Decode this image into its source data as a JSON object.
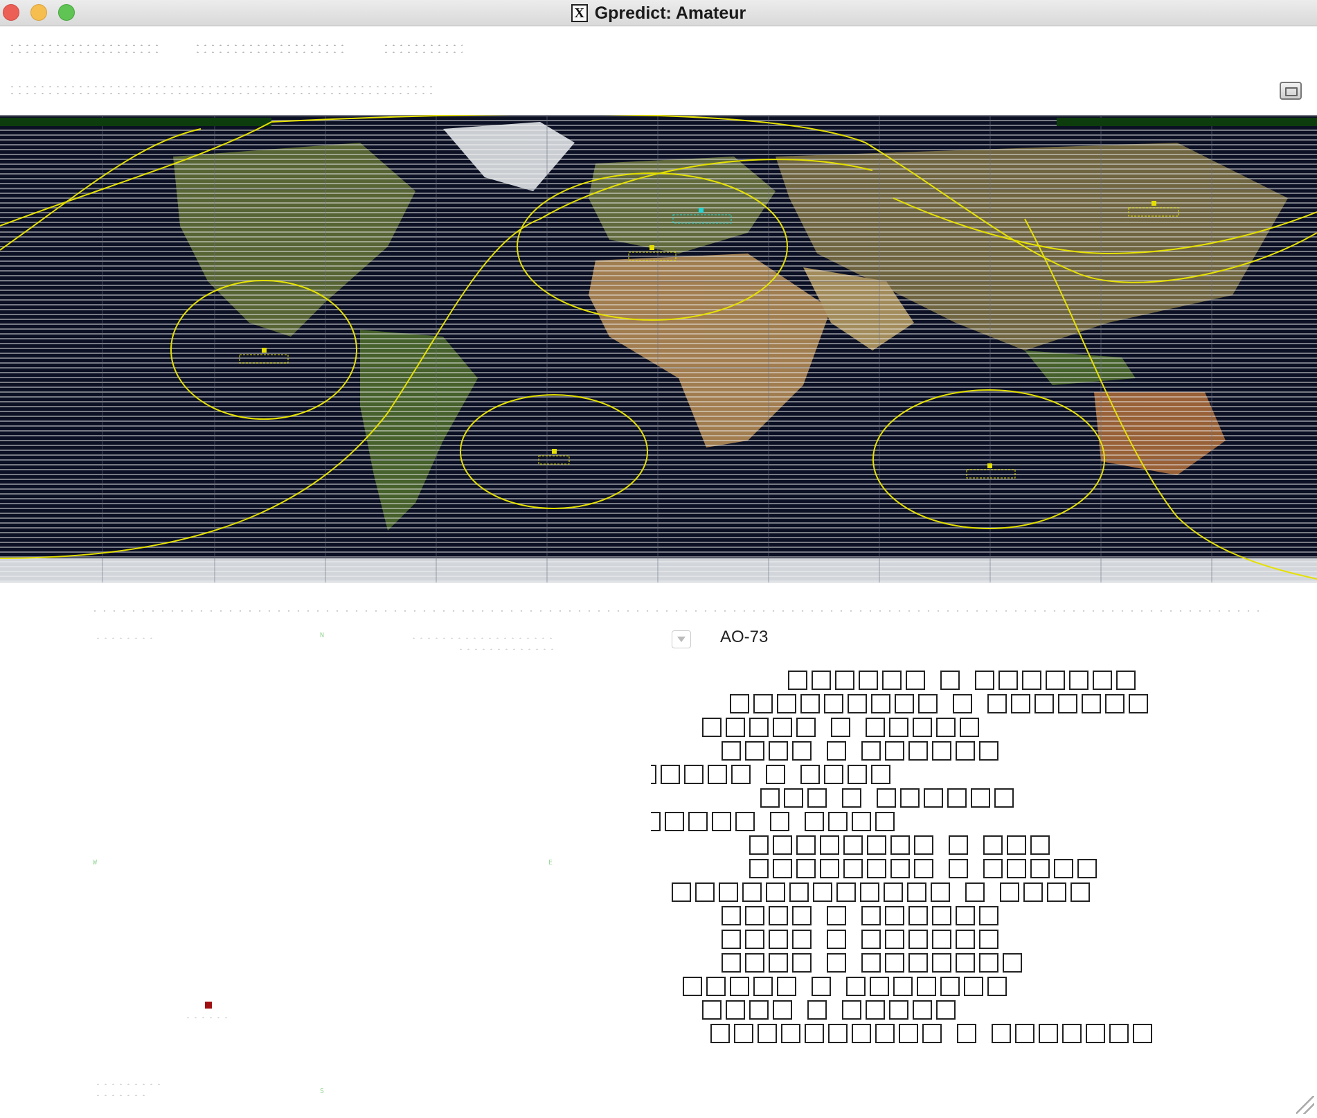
{
  "window": {
    "title": "Gpredict: Amateur",
    "x_icon_glyph": "X"
  },
  "header": {
    "options_icon": "display-options-icon"
  },
  "map": {
    "background": "earth-map",
    "footprint_color": "#e5e000",
    "satellite_color": "#e5e000",
    "selected_satellite_color": "#22d4d4"
  },
  "panel": {
    "selected_satellite": "AO-73",
    "selector_icon": "chevron-down-icon"
  },
  "colors": {
    "titlebar": "#dcdcdc",
    "close": "#ec5f57",
    "minimize": "#f6be4f",
    "maximize": "#5fc454",
    "ground_station": "#a01010"
  }
}
